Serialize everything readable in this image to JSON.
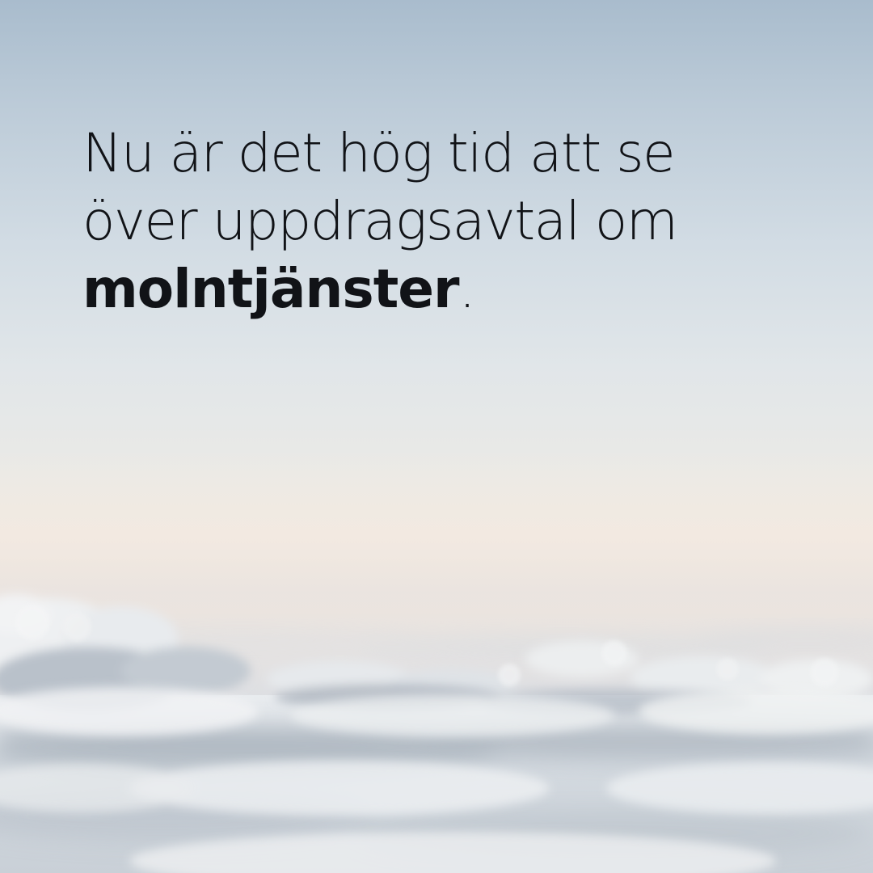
{
  "headline": {
    "line1": "Nu är det hög tid att se",
    "line2": "över uppdragsavtal om",
    "emphasis": "molntjänster",
    "end_punctuation": "."
  },
  "background": {
    "scene": "cloud-sea-icon",
    "colors": {
      "sky_top": "#a9bccd",
      "sky_mid": "#e1e6e9",
      "horizon_glow": "#efe9e2",
      "cloud_light": "#f4f5f6",
      "cloud_shadow": "#9ea8b3",
      "text": "#111317"
    }
  }
}
